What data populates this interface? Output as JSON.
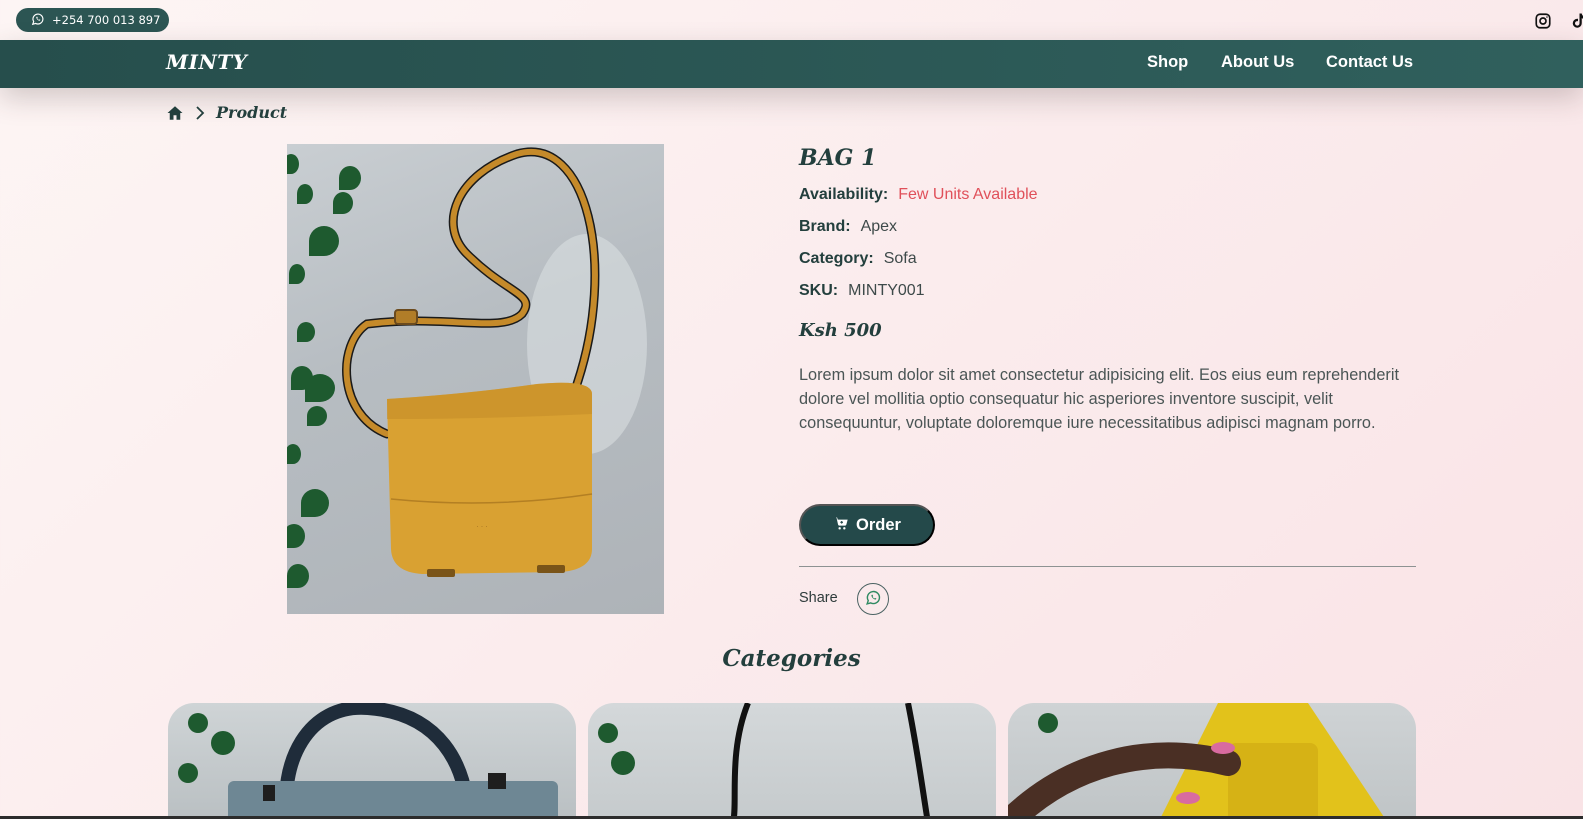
{
  "topbar": {
    "phone": "+254 700 013 897",
    "icons": [
      "whatsapp-icon",
      "instagram-icon",
      "tiktok-icon"
    ]
  },
  "navbar": {
    "brand": "MINTY",
    "links": [
      "Shop",
      "About Us",
      "Contact Us"
    ]
  },
  "breadcrumb": {
    "current": "Product"
  },
  "product": {
    "title": "BAG 1",
    "availability_label": "Availability:",
    "availability_value": "Few Units Available",
    "brand_label": "Brand:",
    "brand_value": "Apex",
    "category_label": "Category:",
    "category_value": "Sofa",
    "sku_label": "SKU:",
    "sku_value": "MINTY001",
    "price": "Ksh 500",
    "description": "Lorem ipsum dolor sit amet consectetur adipisicing elit. Eos eius eum reprehenderit dolore vel mollitia optio consequatur hic asperiores inventore suscipit, velit consequuntur, voluptate doloremque iure necessitatibus adipisci magnam porro.",
    "order_label": "Order",
    "share_label": "Share"
  },
  "categories": {
    "title": "Categories"
  },
  "colors": {
    "primary": "#24494a",
    "nav_bg": "#2c5553",
    "warning": "#e0505a",
    "page_bg": "#fbeced"
  }
}
